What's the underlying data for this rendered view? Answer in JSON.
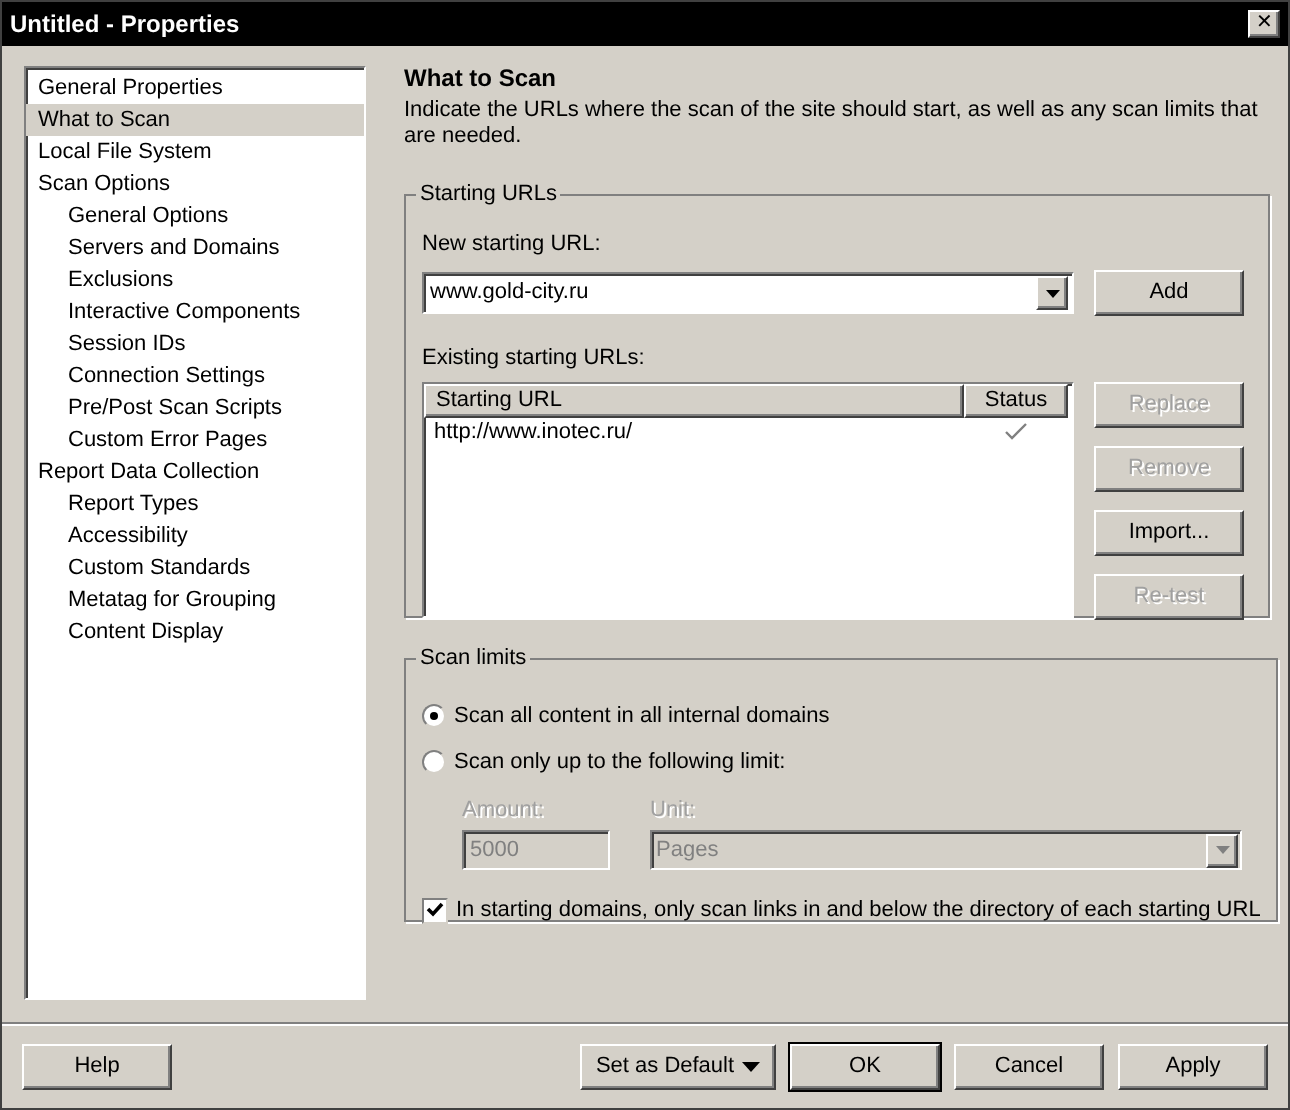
{
  "window": {
    "title": "Untitled - Properties",
    "close": "✕"
  },
  "sidebar": {
    "items": [
      {
        "label": "General Properties",
        "selected": false
      },
      {
        "label": "What to Scan",
        "selected": true
      },
      {
        "label": "Local File System",
        "selected": false
      },
      {
        "label": "Scan Options",
        "selected": false,
        "children": [
          {
            "label": "General Options",
            "selected": false
          },
          {
            "label": "Servers and Domains",
            "selected": false
          },
          {
            "label": "Exclusions",
            "selected": false
          },
          {
            "label": "Interactive Components",
            "selected": false
          },
          {
            "label": "Session IDs",
            "selected": false
          },
          {
            "label": "Connection Settings",
            "selected": false
          },
          {
            "label": "Pre/Post Scan Scripts",
            "selected": false
          },
          {
            "label": "Custom Error Pages",
            "selected": false
          }
        ]
      },
      {
        "label": "Report Data Collection",
        "selected": false,
        "children": [
          {
            "label": "Report Types",
            "selected": false
          },
          {
            "label": "Accessibility",
            "selected": false
          },
          {
            "label": "Custom Standards",
            "selected": false
          },
          {
            "label": "Metatag for Grouping",
            "selected": false
          },
          {
            "label": "Content Display",
            "selected": false
          }
        ]
      }
    ]
  },
  "page": {
    "title": "What to Scan",
    "description": "Indicate the URLs where the scan of the site should start, as well as any scan limits that are needed."
  },
  "starting_urls": {
    "title": "Starting URLs",
    "new_label": "New starting URL:",
    "new_value": "www.gold-city.ru",
    "add_button": "Add",
    "existing_label": "Existing starting URLs:",
    "columns": [
      "Starting URL",
      "Status"
    ],
    "rows": [
      {
        "url": "http://www.inotec.ru/",
        "status_ok": true
      }
    ],
    "buttons": [
      {
        "label": "Replace",
        "disabled": true
      },
      {
        "label": "Remove",
        "disabled": true
      },
      {
        "label": "Import...",
        "disabled": false
      },
      {
        "label": "Re-test",
        "disabled": true
      }
    ]
  },
  "scan_limits": {
    "title": "Scan limits",
    "options": [
      {
        "label": "Scan all content in all internal domains",
        "selected": true
      },
      {
        "label": "Scan only up to the following limit:",
        "selected": false
      }
    ],
    "amount": {
      "label": "Amount:",
      "value": "5000",
      "disabled": true
    },
    "unit": {
      "label": "Unit:",
      "value": "Pages",
      "disabled": true
    },
    "restrict": {
      "label": "In starting domains, only scan links in and below the directory of each starting URL",
      "checked": true
    }
  },
  "footer": {
    "help": "Help",
    "set_default": "Set as Default",
    "ok": "OK",
    "cancel": "Cancel",
    "apply": "Apply"
  }
}
